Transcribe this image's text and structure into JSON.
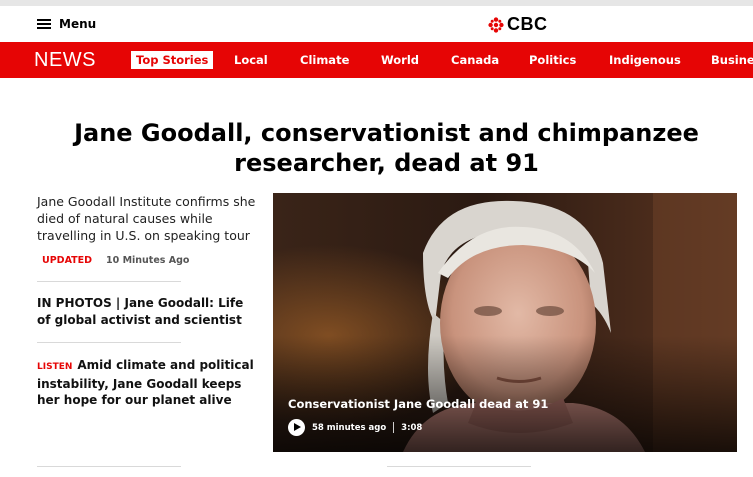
{
  "header": {
    "menu_label": "Menu",
    "logo_text": "CBC"
  },
  "nav": {
    "brand": "NEWS",
    "items": [
      {
        "label": "Top Stories",
        "active": true
      },
      {
        "label": "Local"
      },
      {
        "label": "Climate"
      },
      {
        "label": "World"
      },
      {
        "label": "Canada"
      },
      {
        "label": "Politics"
      },
      {
        "label": "Indigenous"
      },
      {
        "label": "Business"
      }
    ]
  },
  "article": {
    "headline": "Jane Goodall, conservationist and chimpanzee researcher, dead at 91",
    "summary": "Jane Goodall Institute confirms she died of natural causes while travelling in U.S. on speaking tour",
    "updated_label": "UPDATED",
    "updated_time": "10 Minutes Ago"
  },
  "related": [
    {
      "tag": "",
      "title": "IN PHOTOS | Jane Goodall: Life of global activist and scientist"
    },
    {
      "tag": "LISTEN",
      "title": "Amid climate and political instability, Jane Goodall keeps her hope for our planet alive"
    }
  ],
  "media": {
    "caption": "Conservationist Jane Goodall dead at 91",
    "published": "58 minutes ago",
    "duration": "3:08"
  },
  "colors": {
    "brand_red": "#e60505",
    "background": "#ffffff"
  },
  "icons": [
    "menu-icon",
    "cbc-gem-icon",
    "play-icon"
  ]
}
